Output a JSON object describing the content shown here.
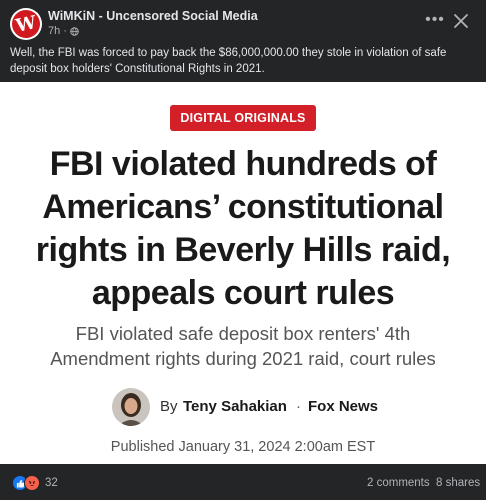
{
  "post": {
    "page_name": "WiMKiN - Uncensored Social Media",
    "time": "7h",
    "audience_icon": "globe-icon",
    "text": "Well, the FBI was forced to pay back the $86,000,000.00 they stole in violation of safe deposit box holders' Constitutional Rights in 2021.",
    "avatar_letter": "W"
  },
  "article": {
    "badge": "DIGITAL ORIGINALS",
    "headline": "FBI violated hundreds of Americans’ constitutional rights in Beverly Hills raid, appeals court rules",
    "subhead": "FBI violated safe deposit box renters' 4th Amendment rights during 2021 raid, court rules",
    "by_label": "By",
    "author": "Teny Sahakian",
    "separator": "·",
    "outlet": "Fox News",
    "published": "Published January 31, 2024 2:00am EST"
  },
  "footer": {
    "reaction_count": "32",
    "comments": "2 comments",
    "shares": "8 shares"
  },
  "colors": {
    "background": "#242526",
    "badge": "#d21f28",
    "like": "#1877f2",
    "angry": "#f7614b"
  }
}
